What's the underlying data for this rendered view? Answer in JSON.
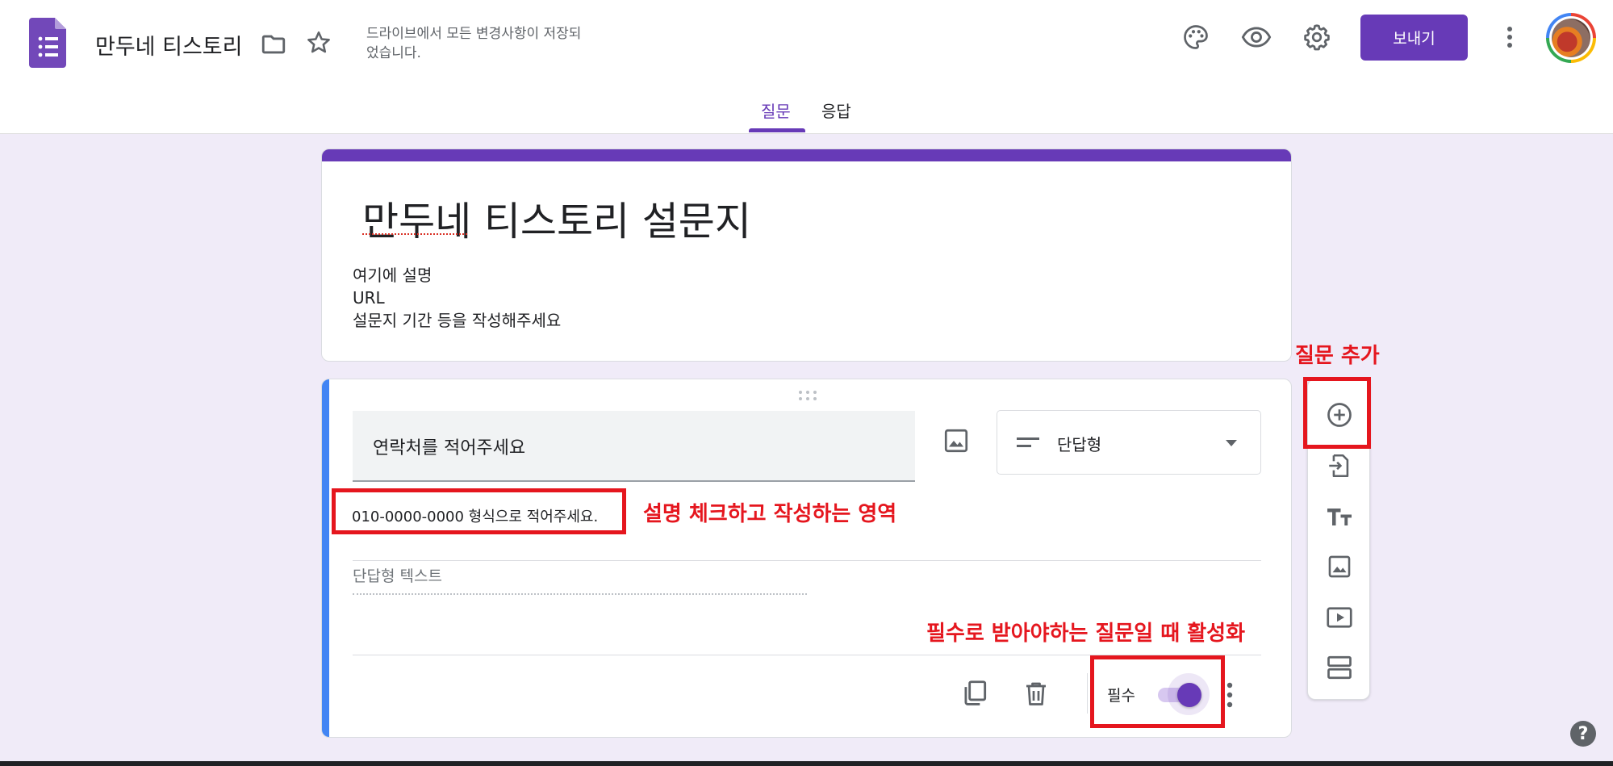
{
  "header": {
    "doc_title": "만두네 티스토리",
    "save_status": "드라이브에서 모든 변경사항이 저장되었습니다.",
    "send_label": "보내기",
    "icons": [
      "palette-icon",
      "preview-eye-icon",
      "settings-gear-icon",
      "more-vert-icon"
    ]
  },
  "tabs": [
    {
      "label": "질문",
      "active": true
    },
    {
      "label": "응답",
      "active": false
    }
  ],
  "form": {
    "title": "만두네 티스토리 설문지",
    "description_lines": [
      "여기에 설명",
      "URL",
      "설문지 기간 등을 작성해주세요"
    ]
  },
  "question": {
    "title": "연락처를 적어주세요",
    "type_label": "단답형",
    "description": "010-0000-0000 형식으로 적어주세요.",
    "answer_placeholder": "단답형 텍스트",
    "required_label": "필수",
    "required": true
  },
  "side_toolbar": [
    "add-question-icon",
    "import-questions-icon",
    "add-title-icon",
    "add-image-icon",
    "add-video-icon",
    "add-section-icon"
  ],
  "annotations": {
    "add_question": "질문 추가",
    "description_area": "설명 체크하고 작성하는 영역",
    "required_toggle": "필수로 받아야하는 질문일 때 활성화"
  },
  "colors": {
    "accent": "#673ab7",
    "annotation_red": "#e5161e",
    "question_accent": "#4285f4",
    "background": "#f0ebf8"
  },
  "help_label": "?"
}
